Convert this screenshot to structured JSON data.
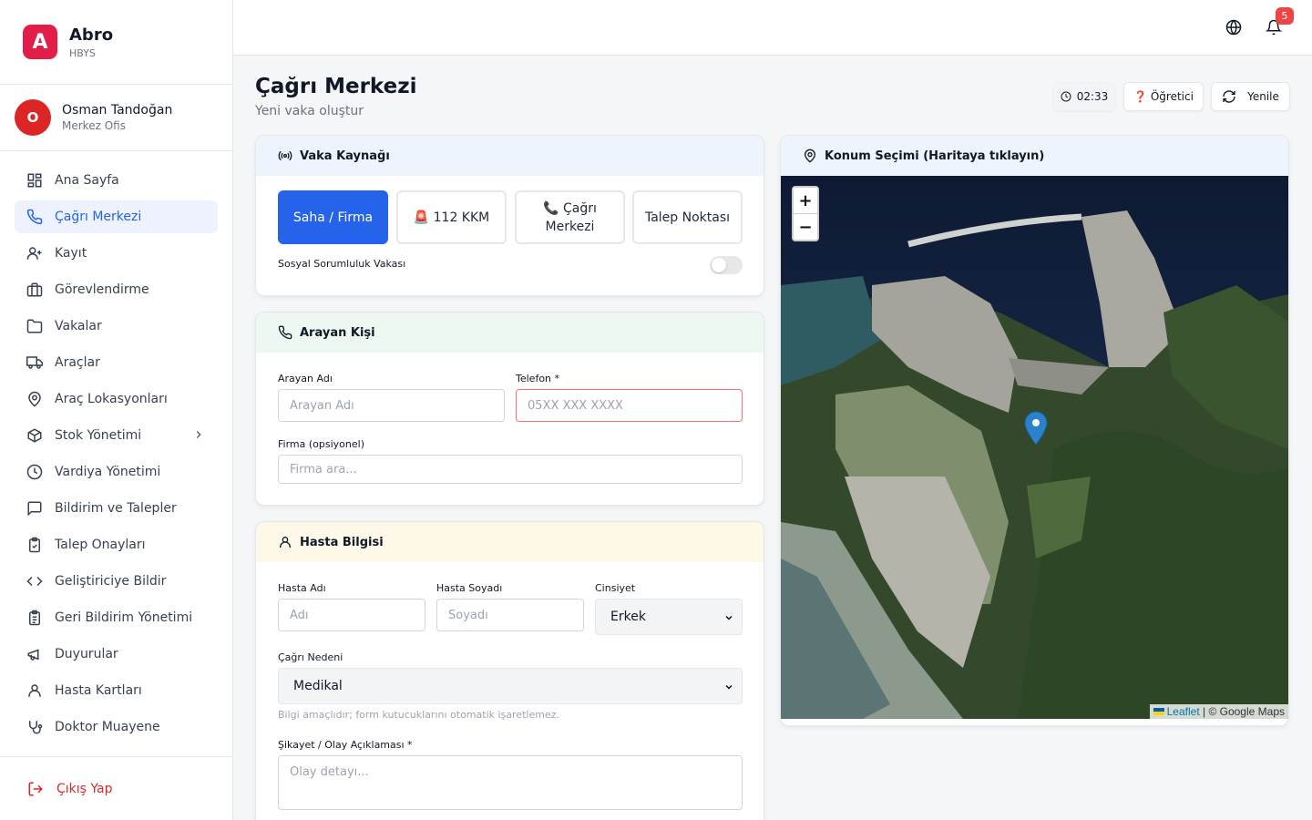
{
  "brand": {
    "name": "Abro",
    "sub": "HBYS",
    "logo_letter": "A"
  },
  "user": {
    "initial": "O",
    "name": "Osman Tandoğan",
    "role": "Merkez Ofis"
  },
  "sidebar": {
    "items": [
      {
        "label": "Ana Sayfa",
        "icon": "grid-icon"
      },
      {
        "label": "Çağrı Merkezi",
        "icon": "phone-icon",
        "active": true
      },
      {
        "label": "Kayıt",
        "icon": "user-plus-icon"
      },
      {
        "label": "Görevlendirme",
        "icon": "briefcase-icon"
      },
      {
        "label": "Vakalar",
        "icon": "folder-icon"
      },
      {
        "label": "Araçlar",
        "icon": "truck-icon"
      },
      {
        "label": "Araç Lokasyonları",
        "icon": "map-pin-icon"
      },
      {
        "label": "Stok Yönetimi",
        "icon": "box-icon"
      },
      {
        "label": "Vardiya Yönetimi",
        "icon": "clock-icon"
      },
      {
        "label": "Bildirim ve Talepler",
        "icon": "message-icon"
      },
      {
        "label": "Talep Onayları",
        "icon": "clipboard-check-icon"
      },
      {
        "label": "Geliştiriciye Bildir",
        "icon": "code-icon"
      },
      {
        "label": "Geri Bildirim Yönetimi",
        "icon": "clipboard-list-icon"
      },
      {
        "label": "Duyurular",
        "icon": "megaphone-icon"
      },
      {
        "label": "Hasta Kartları",
        "icon": "user-icon"
      },
      {
        "label": "Doktor Muayene",
        "icon": "stethoscope-icon"
      }
    ],
    "logout": "Çıkış Yap"
  },
  "topbar": {
    "notification_count": "5"
  },
  "header": {
    "title": "Çağrı Merkezi",
    "subtitle": "Yeni vaka oluştur",
    "timer": "02:33",
    "tutorial": "❓ Öğretici",
    "refresh": "Yenile"
  },
  "source_card": {
    "title": "Vaka Kaynağı",
    "buttons": [
      "Saha / Firma",
      "🚨 112 KKM",
      "📞 Çağrı Merkezi",
      "Talep Noktası"
    ],
    "active_index": 0,
    "toggle_label": "Sosyal Sorumluluk Vakası",
    "toggle_on": false
  },
  "caller_card": {
    "title": "Arayan Kişi",
    "name_label": "Arayan Adı",
    "name_placeholder": "Arayan Adı",
    "phone_label": "Telefon *",
    "phone_placeholder": "05XX XXX XXXX",
    "company_label": "Firma (opsiyonel)",
    "company_placeholder": "Firma ara..."
  },
  "patient_card": {
    "title": "Hasta Bilgisi",
    "first_label": "Hasta Adı",
    "first_placeholder": "Adı",
    "last_label": "Hasta Soyadı",
    "last_placeholder": "Soyadı",
    "gender_label": "Cinsiyet",
    "gender_value": "Erkek",
    "reason_label": "Çağrı Nedeni",
    "reason_value": "Medikal",
    "reason_hint": "Bilgi amaçlıdır; form kutucuklarını otomatik işaretlemez.",
    "complaint_label": "Şikayet / Olay Açıklaması *",
    "complaint_placeholder": "Olay detayı..."
  },
  "map_card": {
    "title": "Konum Seçimi (Haritaya tıklayın)",
    "zoom_in": "+",
    "zoom_out": "−",
    "attribution_leaflet": "Leaflet",
    "attribution_rest": " | © Google Maps"
  },
  "colors": {
    "accent": "#2563eb",
    "brand": "#e11d48",
    "danger": "#dc2626"
  }
}
